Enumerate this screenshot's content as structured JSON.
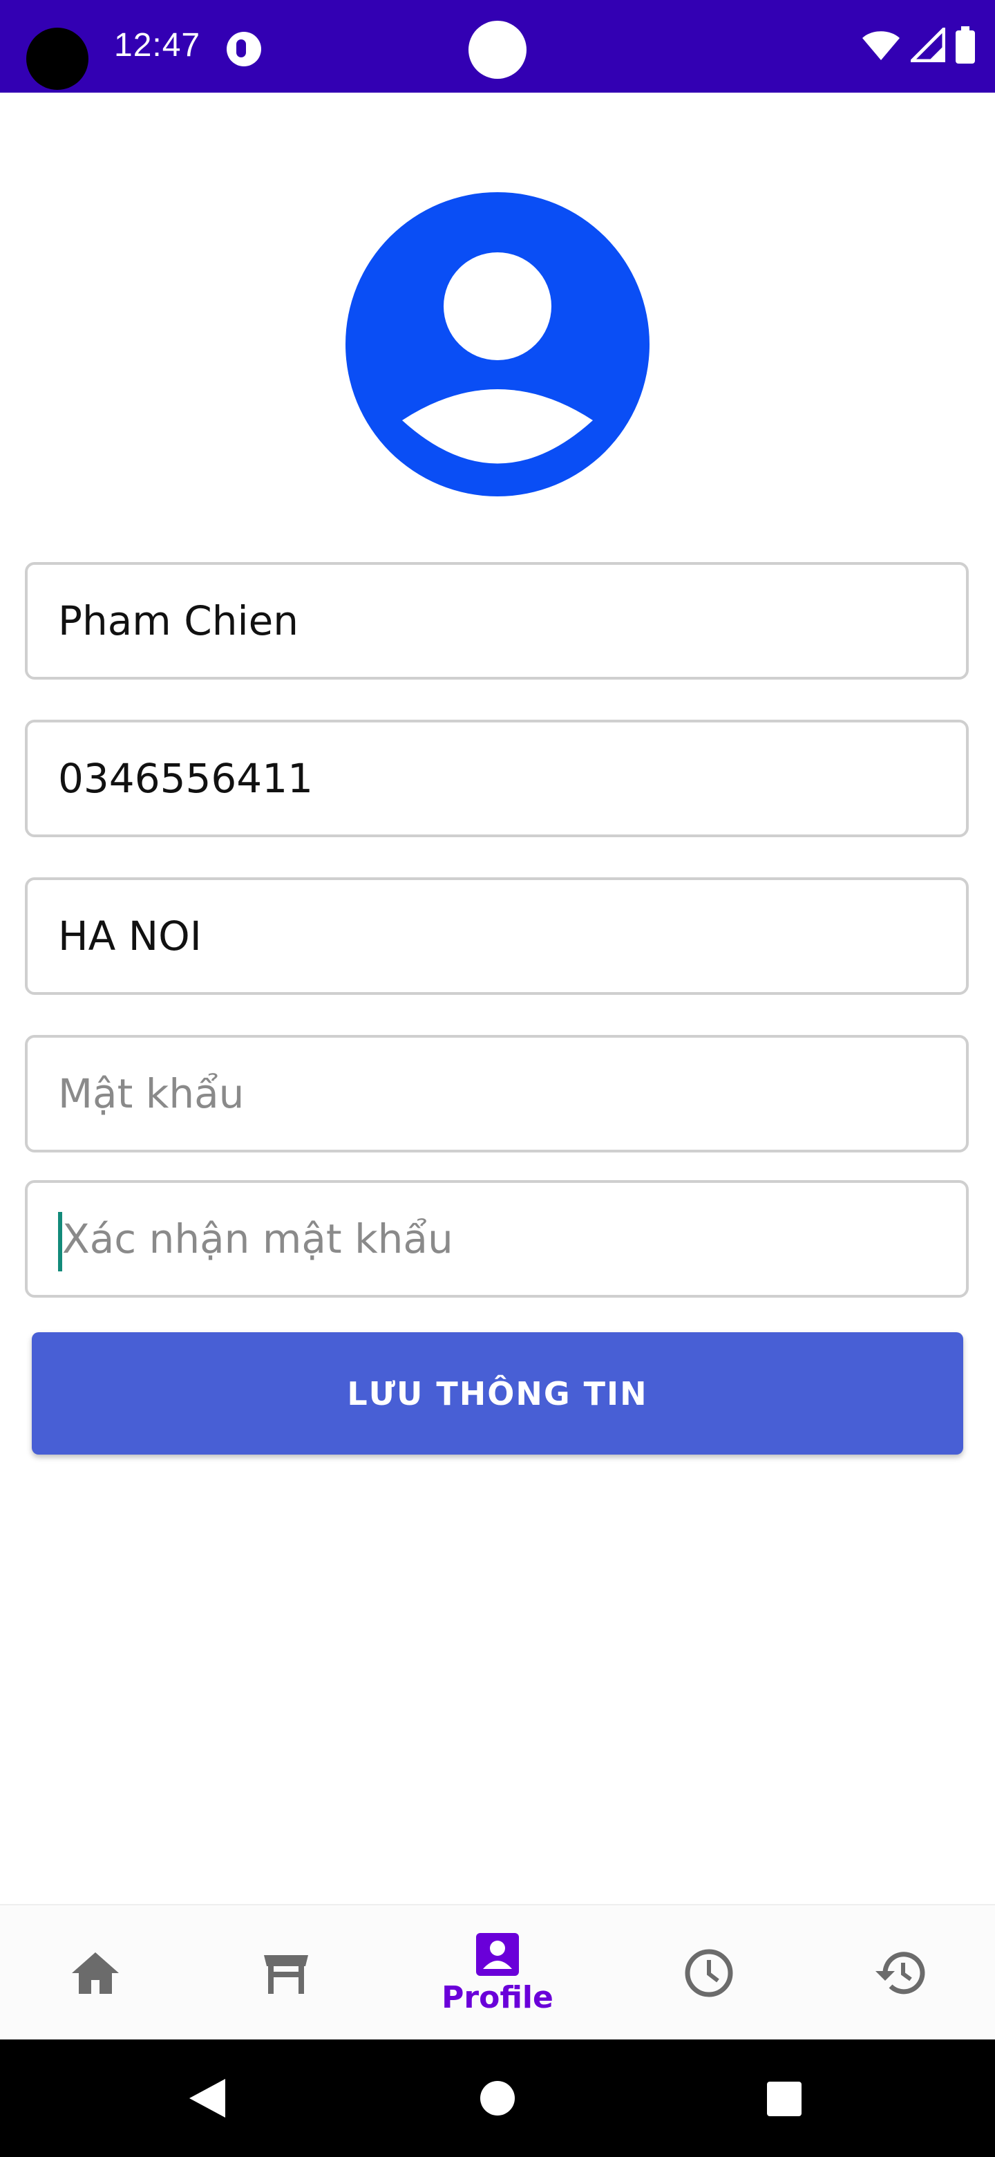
{
  "status_bar": {
    "time": "12:47",
    "icons": [
      "notification-p-icon",
      "wifi-icon",
      "signal-icon",
      "battery-icon"
    ]
  },
  "profile": {
    "avatar_icon": "account-circle-icon",
    "avatar_color": "#0a4ef5",
    "name": "Pham Chien",
    "phone": "0346556411",
    "address": "HA NOI",
    "password_placeholder": "Mật khẩu",
    "confirm_password_placeholder": "Xác nhận mật khẩu",
    "save_label": "LƯU THÔNG TIN",
    "save_color": "#485fd5"
  },
  "bottom_nav": {
    "items": [
      {
        "icon": "home-icon",
        "label": ""
      },
      {
        "icon": "table-icon",
        "label": ""
      },
      {
        "icon": "profile-icon",
        "label": "Profile",
        "active": true
      },
      {
        "icon": "clock-icon",
        "label": ""
      },
      {
        "icon": "history-icon",
        "label": ""
      }
    ],
    "active_color": "#6a00d9",
    "inactive_color": "#6b6b6b"
  },
  "system_nav": {
    "buttons": [
      "back-icon",
      "home-circle-icon",
      "recents-icon"
    ]
  }
}
